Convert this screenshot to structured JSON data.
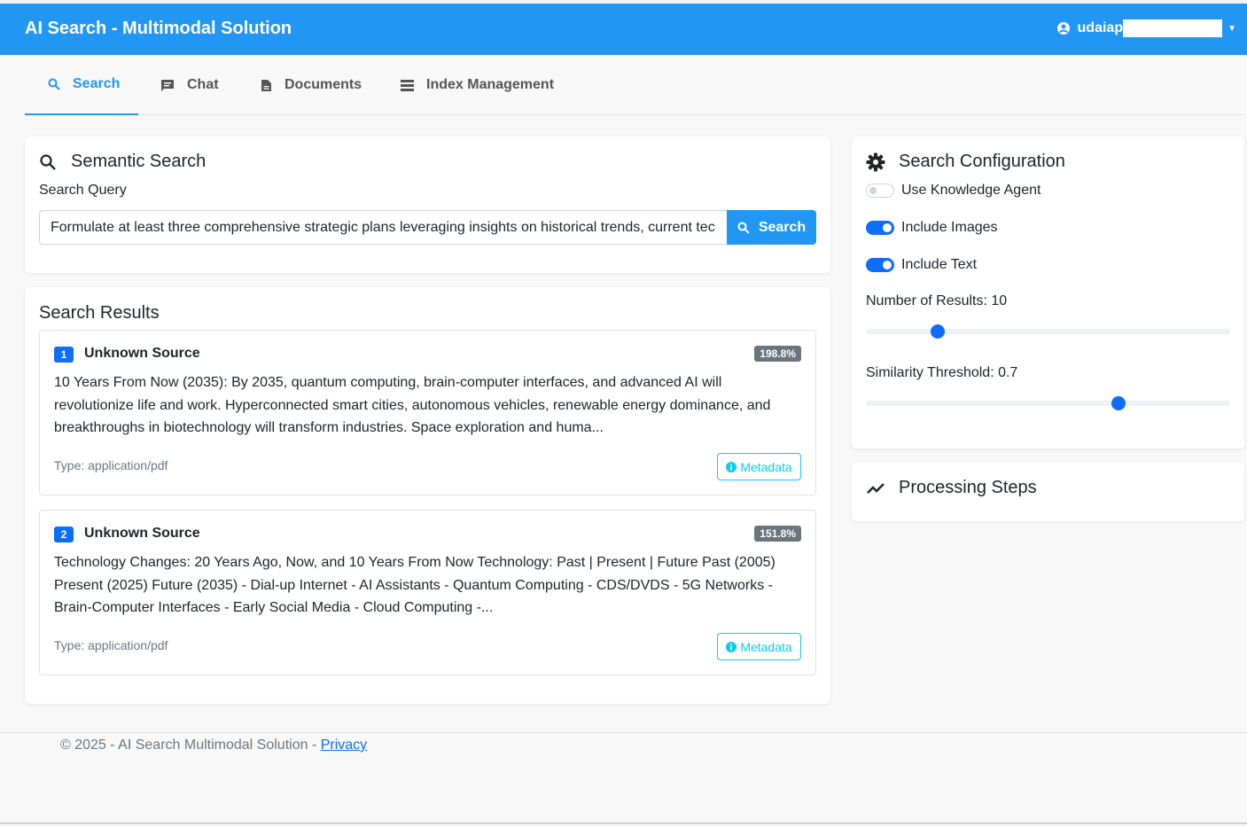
{
  "app": {
    "title": "AI Search - Multimodal Solution",
    "user": "udaiap"
  },
  "tabs": [
    {
      "label": "Search",
      "icon": "search-icon",
      "active": true
    },
    {
      "label": "Chat",
      "icon": "chat-icon",
      "active": false
    },
    {
      "label": "Documents",
      "icon": "document-icon",
      "active": false
    },
    {
      "label": "Index Management",
      "icon": "list-icon",
      "active": false
    }
  ],
  "search": {
    "title": "Semantic Search",
    "query_label": "Search Query",
    "query_value": "Formulate at least three comprehensive strategic plans leveraging insights on historical trends, current tec",
    "button_label": "Search"
  },
  "results": {
    "title": "Search Results",
    "items": [
      {
        "rank": "1",
        "source": "Unknown Source",
        "score": "198.8%",
        "snippet": "10 Years From Now (2035): By 2035, quantum computing, brain-computer interfaces, and advanced AI will revolutionize life and work. Hyperconnected smart cities, autonomous vehicles, renewable energy dominance, and breakthroughs in biotechnology will transform industries. Space exploration and huma...",
        "type": "Type: application/pdf",
        "metadata_label": "Metadata"
      },
      {
        "rank": "2",
        "source": "Unknown Source",
        "score": "151.8%",
        "snippet": "Technology Changes: 20 Years Ago, Now, and 10 Years From Now Technology: Past | Present | Future Past (2005) Present (2025) Future (2035) - Dial-up Internet - AI Assistants - Quantum Computing - CDS/DVDS - 5G Networks - Brain-Computer Interfaces - Early Social Media - Cloud Computing -...",
        "type": "Type: application/pdf",
        "metadata_label": "Metadata"
      }
    ]
  },
  "config": {
    "title": "Search Configuration",
    "use_knowledge_agent": {
      "label": "Use Knowledge Agent",
      "enabled": false
    },
    "include_images": {
      "label": "Include Images",
      "enabled": true
    },
    "include_text": {
      "label": "Include Text",
      "enabled": true
    },
    "num_results": {
      "label": "Number of Results: 10",
      "value": 10,
      "min": 1,
      "max": 50
    },
    "similarity": {
      "label": "Similarity Threshold: 0.7",
      "value": 0.7,
      "min": 0,
      "max": 1
    }
  },
  "processing": {
    "title": "Processing Steps"
  },
  "footer": {
    "text": "© 2025 - AI Search Multimodal Solution - ",
    "link": "Privacy"
  },
  "colors": {
    "primary": "#2196f3",
    "badge_blue": "#0d6efd",
    "score_gray": "#6c757d",
    "info": "#0dcaf0"
  }
}
